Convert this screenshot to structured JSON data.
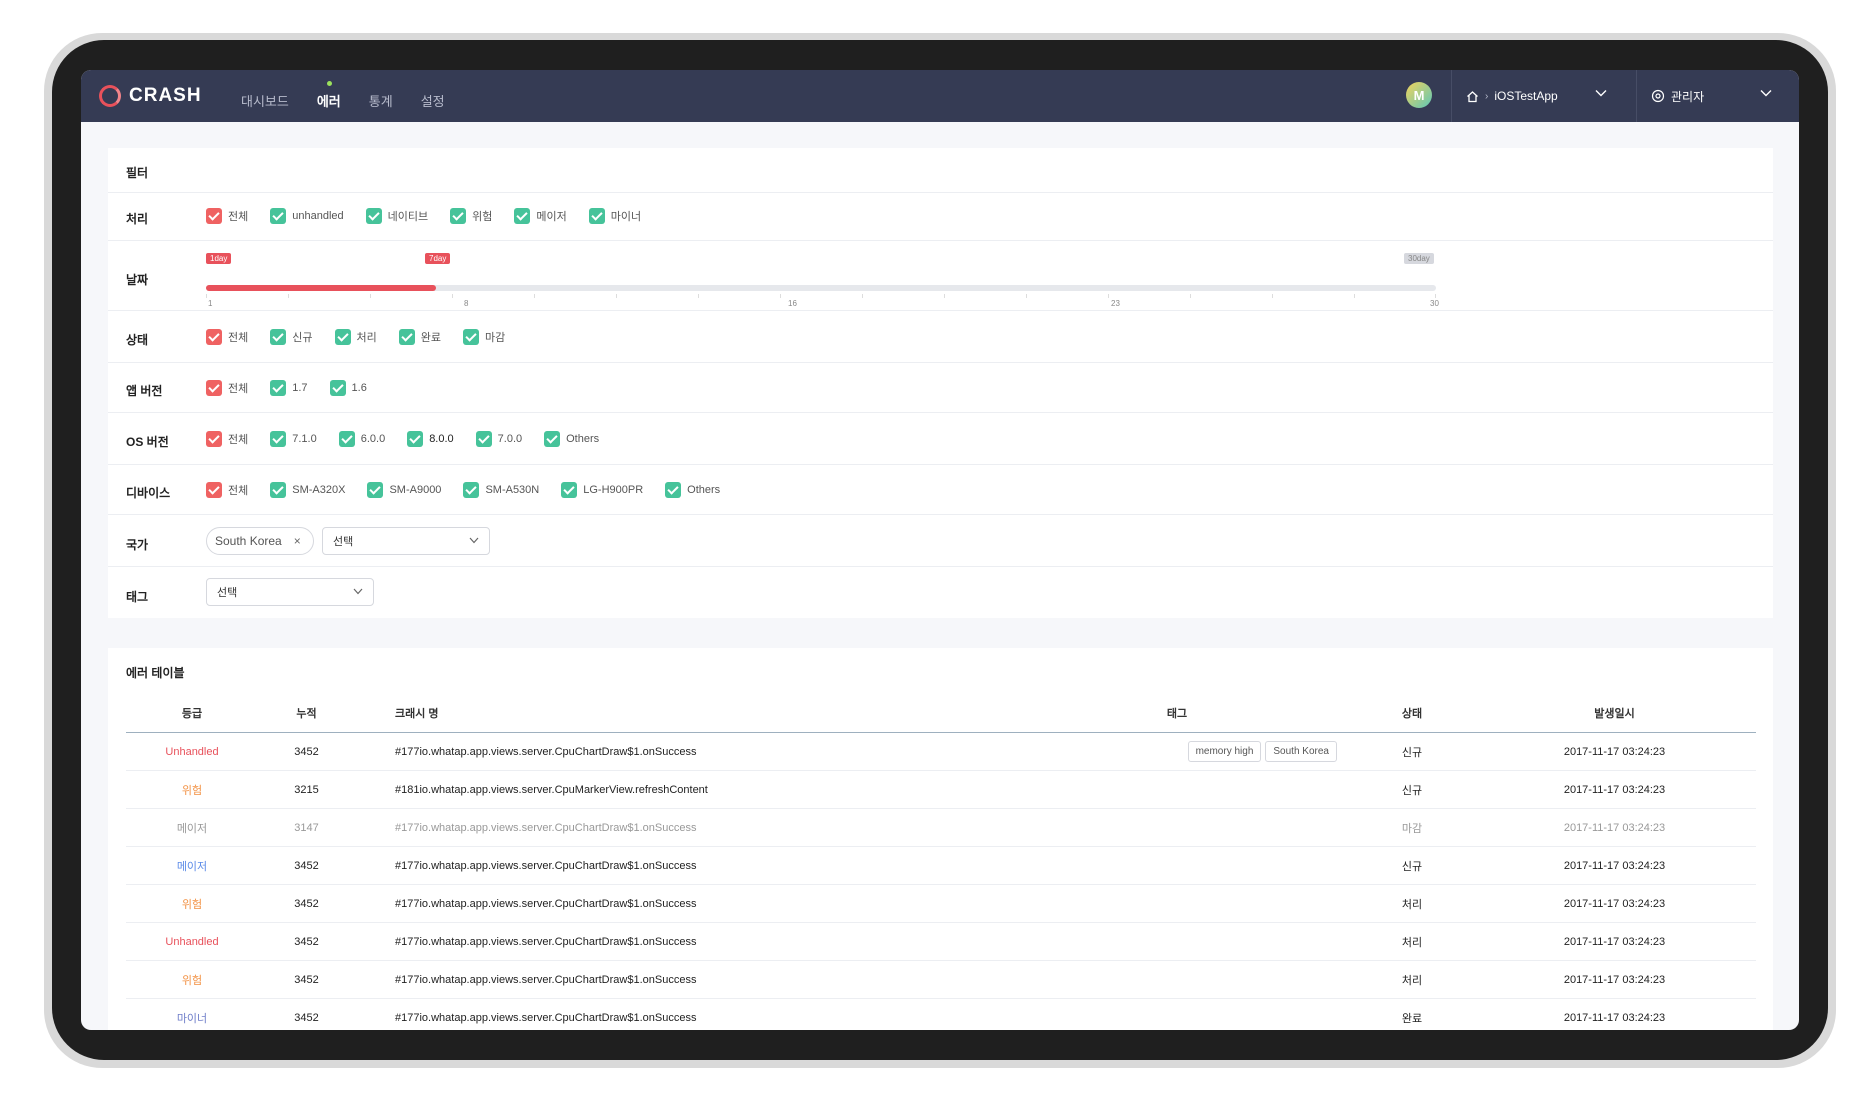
{
  "nav": {
    "logo": "CRASH",
    "menu": [
      {
        "label": "대시보드",
        "active": false
      },
      {
        "label": "에러",
        "active": true
      },
      {
        "label": "통계",
        "active": false
      },
      {
        "label": "설정",
        "active": false
      }
    ],
    "avatar_initial": "M",
    "app_name": "iOSTestApp",
    "admin_label": "관리자"
  },
  "filter": {
    "title": "필터",
    "rows": {
      "process": {
        "label": "처리",
        "items": [
          "전체",
          "unhandled",
          "네이티브",
          "위험",
          "메이저",
          "마이너"
        ]
      },
      "date": {
        "label": "날짜",
        "flags": [
          "1day",
          "7day",
          "30day"
        ],
        "ticks": [
          "1",
          "8",
          "16",
          "23",
          "30"
        ],
        "selected_days": 7
      },
      "status": {
        "label": "상태",
        "items": [
          "전체",
          "신규",
          "처리",
          "완료",
          "마감"
        ]
      },
      "app_version": {
        "label": "앱 버전",
        "items": [
          "전체",
          "1.7",
          "1.6"
        ]
      },
      "os_version": {
        "label": "OS 버전",
        "items": [
          "전체",
          "7.1.0",
          "6.0.0",
          "8.0.0",
          "7.0.0",
          "Others"
        ]
      },
      "device": {
        "label": "디바이스",
        "items": [
          "전체",
          "SM-A320X",
          "SM-A9000",
          "SM-A530N",
          "LG-H900PR",
          "Others"
        ]
      },
      "country": {
        "label": "국가",
        "chip": "South Korea",
        "chip_remove": "×",
        "select": "선택"
      },
      "tag": {
        "label": "태그",
        "select": "선택"
      }
    }
  },
  "table": {
    "title": "에러 테이블",
    "headers": {
      "grade": "등급",
      "count": "누적",
      "name": "크래시 명",
      "tag": "태그",
      "status": "상태",
      "date": "발생일시"
    },
    "rows": [
      {
        "grade": "Unhandled",
        "count": "3452",
        "name": "#177io.whatap.app.views.server.CpuChartDraw$1.onSuccess",
        "tags": [
          "memory high",
          "South Korea"
        ],
        "status": "신규",
        "date": "2017-11-17 03:24:23"
      },
      {
        "grade": "위험",
        "count": "3215",
        "name": "#181io.whatap.app.views.server.CpuMarkerView.refreshContent",
        "tags": [],
        "status": "신규",
        "date": "2017-11-17 03:24:23"
      },
      {
        "grade": "메이저",
        "count": "3147",
        "name": "#177io.whatap.app.views.server.CpuChartDraw$1.onSuccess",
        "tags": [],
        "status": "마감",
        "date": "2017-11-17 03:24:23"
      },
      {
        "grade": "메이저",
        "count": "3452",
        "name": "#177io.whatap.app.views.server.CpuChartDraw$1.onSuccess",
        "tags": [],
        "status": "신규",
        "date": "2017-11-17 03:24:23"
      },
      {
        "grade": "위험",
        "count": "3452",
        "name": "#177io.whatap.app.views.server.CpuChartDraw$1.onSuccess",
        "tags": [],
        "status": "처리",
        "date": "2017-11-17 03:24:23"
      },
      {
        "grade": "Unhandled",
        "count": "3452",
        "name": "#177io.whatap.app.views.server.CpuChartDraw$1.onSuccess",
        "tags": [],
        "status": "처리",
        "date": "2017-11-17 03:24:23"
      },
      {
        "grade": "위험",
        "count": "3452",
        "name": "#177io.whatap.app.views.server.CpuChartDraw$1.onSuccess",
        "tags": [],
        "status": "처리",
        "date": "2017-11-17 03:24:23"
      },
      {
        "grade": "마이너",
        "count": "3452",
        "name": "#177io.whatap.app.views.server.CpuChartDraw$1.onSuccess",
        "tags": [],
        "status": "완료",
        "date": "2017-11-17 03:24:23"
      }
    ]
  },
  "colors": {
    "accent": "#e8515b",
    "check": "#46c39a",
    "nav_bg": "#353b54",
    "major": "#5b8be8",
    "warn": "#f29042"
  }
}
